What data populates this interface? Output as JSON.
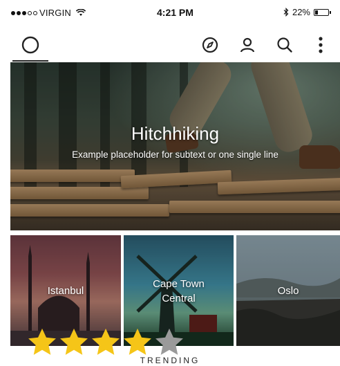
{
  "status_bar": {
    "carrier": "VIRGIN",
    "signal_bars_filled": 3,
    "signal_bars_total": 5,
    "time": "4:21 PM",
    "battery_percent": "22%",
    "battery_level": 0.22
  },
  "app_bar": {
    "left_icon": "circle-icon",
    "icons": [
      "compass-icon",
      "user-icon",
      "search-icon",
      "more-vertical-icon"
    ]
  },
  "hero": {
    "title": "Hitchhiking",
    "subtitle": "Example placeholder for subtext or one single line"
  },
  "cities": [
    {
      "name": "Istanbul"
    },
    {
      "name": "Cape Town\nCentral"
    },
    {
      "name": "Oslo"
    }
  ],
  "rating": {
    "value": 4,
    "max": 5,
    "filled_color": "#f5c518",
    "empty_color": "#9a9a9a"
  },
  "section": {
    "label": "TRENDING"
  }
}
